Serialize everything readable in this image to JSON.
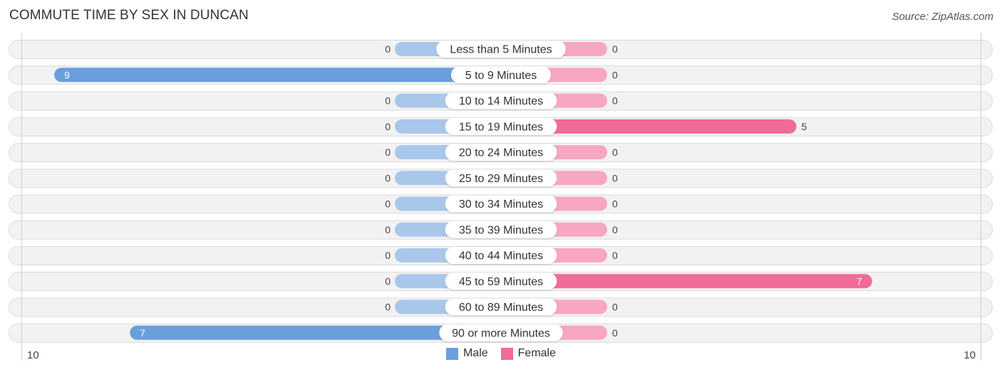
{
  "header": {
    "title": "COMMUTE TIME BY SEX IN DUNCAN",
    "source": "Source: ZipAtlas.com"
  },
  "colors": {
    "male": "#6a9fdc",
    "male_light": "#a9c7ea",
    "female": "#f06b95",
    "female_light": "#f7a8c0",
    "track": "#f2f2f2",
    "track_border": "#dcdcdc"
  },
  "legend": [
    {
      "label": "Male",
      "color": "#6a9fdc"
    },
    {
      "label": "Female",
      "color": "#f06b95"
    }
  ],
  "chart_data": {
    "type": "bar",
    "orientation": "horizontal-diverging",
    "title": "COMMUTE TIME BY SEX IN DUNCAN",
    "categories": [
      "Less than 5 Minutes",
      "5 to 9 Minutes",
      "10 to 14 Minutes",
      "15 to 19 Minutes",
      "20 to 24 Minutes",
      "25 to 29 Minutes",
      "30 to 34 Minutes",
      "35 to 39 Minutes",
      "40 to 44 Minutes",
      "45 to 59 Minutes",
      "60 to 89 Minutes",
      "90 or more Minutes"
    ],
    "series": [
      {
        "name": "Male",
        "values": [
          0,
          9,
          0,
          0,
          0,
          0,
          0,
          0,
          0,
          0,
          0,
          7
        ]
      },
      {
        "name": "Female",
        "values": [
          0,
          0,
          0,
          5,
          0,
          0,
          0,
          0,
          0,
          7,
          0,
          0
        ]
      }
    ],
    "axis": {
      "left_label": "10",
      "right_label": "10",
      "range": [
        0,
        10
      ]
    },
    "legend_position": "bottom-center",
    "grid": false
  }
}
